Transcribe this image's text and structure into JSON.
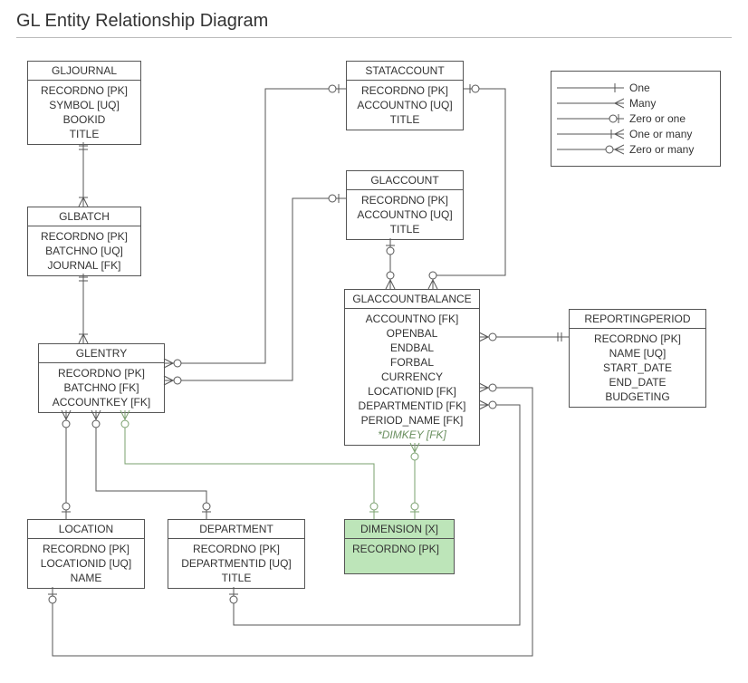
{
  "title": "GL Entity Relationship Diagram",
  "legend": {
    "one": "One",
    "many": "Many",
    "zero_or_one": "Zero or one",
    "one_or_many": "One or many",
    "zero_or_many": "Zero or many"
  },
  "entities": {
    "gljournal": {
      "name": "GLJOURNAL",
      "fields": [
        "RECORDNO [PK]",
        "SYMBOL [UQ]",
        "BOOKID",
        "TITLE"
      ]
    },
    "glbatch": {
      "name": "GLBATCH",
      "fields": [
        "RECORDNO [PK]",
        "BATCHNO [UQ]",
        "JOURNAL [FK]"
      ]
    },
    "glentry": {
      "name": "GLENTRY",
      "fields": [
        "RECORDNO [PK]",
        "BATCHNO [FK]",
        "ACCOUNTKEY [FK]"
      ]
    },
    "stataccount": {
      "name": "STATACCOUNT",
      "fields": [
        "RECORDNO [PK]",
        "ACCOUNTNO [UQ]",
        "TITLE"
      ]
    },
    "glaccount": {
      "name": "GLACCOUNT",
      "fields": [
        "RECORDNO [PK]",
        "ACCOUNTNO [UQ]",
        "TITLE"
      ]
    },
    "glaccountbalance": {
      "name": "GLACCOUNTBALANCE",
      "fields": [
        "ACCOUNTNO [FK]",
        "OPENBAL",
        "ENDBAL",
        "FORBAL",
        "CURRENCY",
        "LOCATIONID [FK]",
        "DEPARTMENTID [FK]",
        "PERIOD_NAME [FK]"
      ],
      "italic_field": "*DIMKEY [FK]"
    },
    "reportingperiod": {
      "name": "REPORTINGPERIOD",
      "fields": [
        "RECORDNO [PK]",
        "NAME [UQ]",
        "START_DATE",
        "END_DATE",
        "BUDGETING"
      ]
    },
    "location": {
      "name": "LOCATION",
      "fields": [
        "RECORDNO [PK]",
        "LOCATIONID [UQ]",
        "NAME"
      ]
    },
    "department": {
      "name": "DEPARTMENT",
      "fields": [
        "RECORDNO [PK]",
        "DEPARTMENTID [UQ]",
        "TITLE"
      ]
    },
    "dimension": {
      "name": "DIMENSION [X]",
      "fields": [
        "RECORDNO [PK]"
      ]
    }
  }
}
